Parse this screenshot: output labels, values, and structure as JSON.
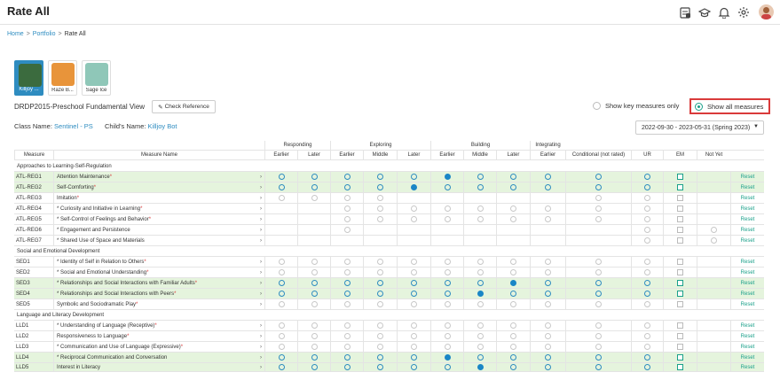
{
  "header": {
    "title": "Rate All",
    "icons": [
      "clipboard-icon",
      "graduation-cap-icon",
      "bell-icon",
      "gear-icon",
      "user-avatar"
    ]
  },
  "breadcrumb": {
    "home": "Home",
    "portfolio": "Portfolio",
    "current": "Rate All"
  },
  "children": [
    {
      "name": "Killjoy ...",
      "selected": true,
      "color": "#3b6b3e"
    },
    {
      "name": "Raze B...",
      "selected": false,
      "color": "#e8943a"
    },
    {
      "name": "Sage Ice",
      "selected": false,
      "color": "#8fc7b8"
    }
  ],
  "framework": {
    "title": "DRDP2015-Preschool Fundamental View",
    "check_reference": "Check Reference"
  },
  "filters": {
    "key_label": "Show key measures only",
    "all_label": "Show all measures",
    "selected": "all"
  },
  "class_info": {
    "class_label": "Class Name:",
    "class_value": "Sentinel - PS",
    "child_label": "Child's Name:",
    "child_value": "Killjoy Bot"
  },
  "period": {
    "label": "2022-09-30 - 2023-05-31 (Spring 2023)"
  },
  "table": {
    "group_headers": [
      "Responding",
      "Exploring",
      "Building",
      "Integrating"
    ],
    "col_headers": [
      "Measure",
      "Measure Name",
      "Earlier",
      "Later",
      "Earlier",
      "Middle",
      "Later",
      "Earlier",
      "Middle",
      "Later",
      "Earlier",
      "Conditional (not rated)",
      "UR",
      "EM",
      "Not Yet"
    ],
    "reset_label": "Reset",
    "sections": [
      {
        "title": "Approaches to Learning-Self-Regulation",
        "rows": [
          {
            "code": "ATL-REG1",
            "name": "Attention Maintenance",
            "star": true,
            "green": true,
            "fill": [
              5
            ]
          },
          {
            "code": "ATL-REG2",
            "name": "Self-Comforting",
            "star": true,
            "green": true,
            "fill": [
              4
            ]
          },
          {
            "code": "ATL-REG3",
            "name": "Imitation",
            "star": true,
            "green": false,
            "fill": []
          },
          {
            "code": "ATL-REG4",
            "name": "* Curiosity and Initiative in Learning",
            "star": true,
            "green": false,
            "fill": []
          },
          {
            "code": "ATL-REG5",
            "name": "* Self-Control of Feelings and Behavior",
            "star": true,
            "green": false,
            "fill": []
          },
          {
            "code": "ATL-REG6",
            "name": "* Engagement and Persistence",
            "star": false,
            "green": false,
            "fill": []
          },
          {
            "code": "ATL-REG7",
            "name": "* Shared Use of Space and Materials",
            "star": false,
            "green": false,
            "fill": []
          }
        ]
      },
      {
        "title": "Social and Emotional Development",
        "rows": [
          {
            "code": "SED1",
            "name": "* Identity of Self in Relation to Others",
            "star": true,
            "green": false,
            "fill": []
          },
          {
            "code": "SED2",
            "name": "* Social and Emotional Understanding",
            "star": true,
            "green": false,
            "fill": []
          },
          {
            "code": "SED3",
            "name": "* Relationships and Social Interactions with Familiar Adults",
            "star": true,
            "green": true,
            "fill": [
              7
            ]
          },
          {
            "code": "SED4",
            "name": "* Relationships and Social Interactions with Peers",
            "star": true,
            "green": true,
            "fill": [
              6
            ]
          },
          {
            "code": "SED5",
            "name": "Symbolic and Sociodramatic Play",
            "star": true,
            "green": false,
            "fill": []
          }
        ]
      },
      {
        "title": "Language and Literacy Development",
        "rows": [
          {
            "code": "LLD1",
            "name": "* Understanding of Language (Receptive)",
            "star": true,
            "green": false,
            "fill": []
          },
          {
            "code": "LLD2",
            "name": "Responsiveness to Language",
            "star": true,
            "green": false,
            "fill": []
          },
          {
            "code": "LLD3",
            "name": "* Communication and Use of Language (Expressive)",
            "star": true,
            "green": false,
            "fill": []
          },
          {
            "code": "LLD4",
            "name": "* Reciprocal Communication and Conversation",
            "star": false,
            "green": true,
            "fill": [
              5
            ]
          },
          {
            "code": "LLD5",
            "name": "Interest in Literacy",
            "star": false,
            "green": true,
            "fill": [
              6
            ]
          }
        ]
      }
    ]
  }
}
